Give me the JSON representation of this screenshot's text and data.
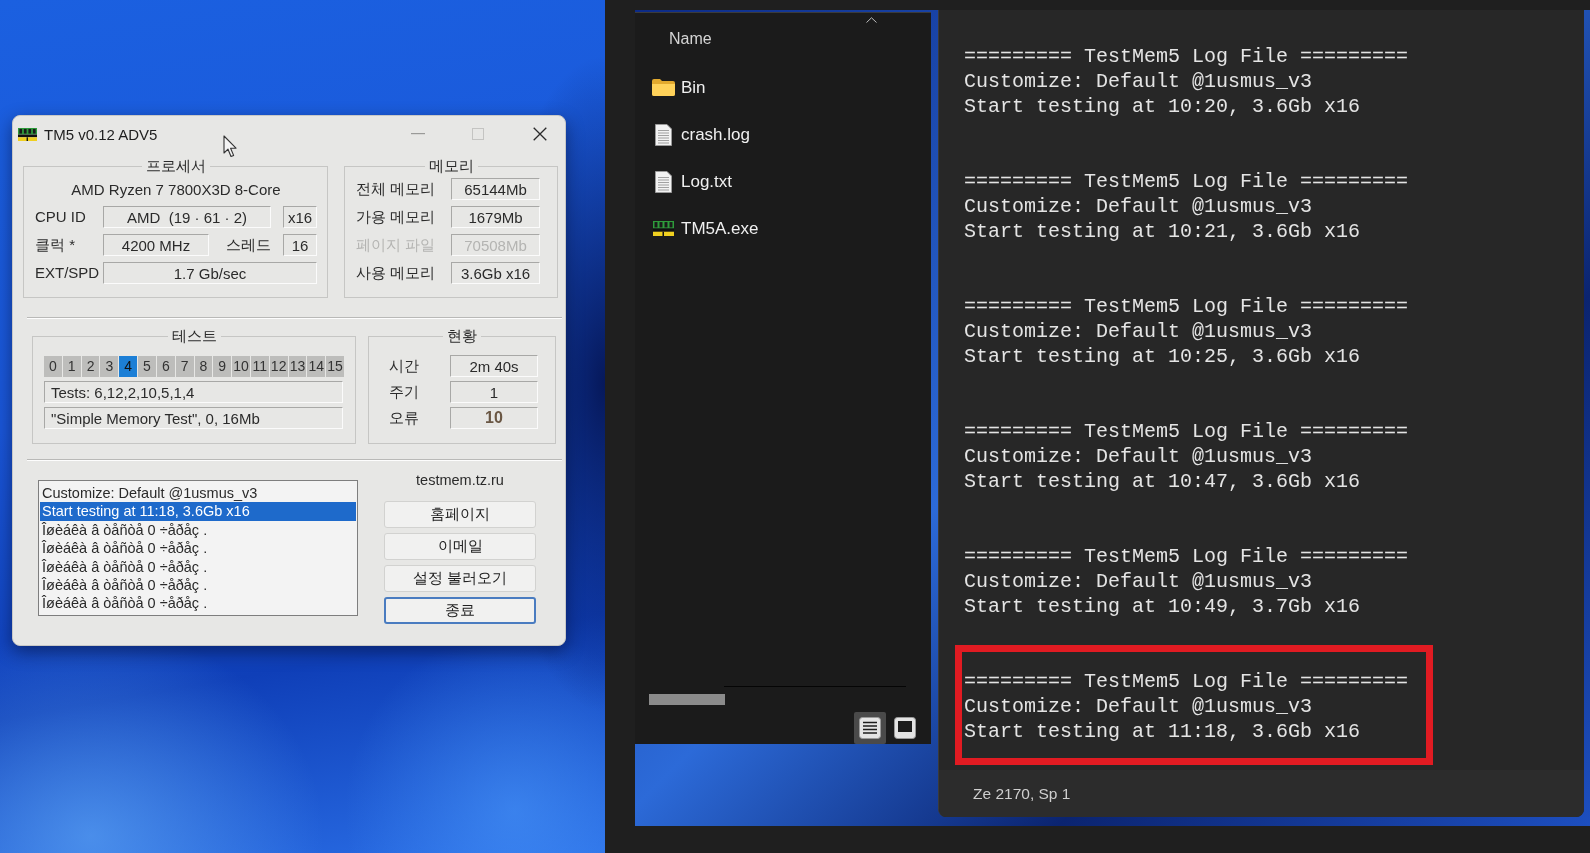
{
  "tm5_window": {
    "title": "TM5 v0.12 ADV5",
    "processor": {
      "heading": "프로세서",
      "model": "AMD Ryzen 7 7800X3D 8-Core",
      "cpu_id_label": "CPU ID",
      "cpu_id": "AMD  (19 · 61 · 2)",
      "cpu_id_side_value": "x16",
      "clock_label": "클럭 *",
      "clock": "4200 MHz",
      "threads_label": "스레드",
      "threads": "16",
      "ext_spd_label": "EXT/SPD",
      "ext_spd": "1.7 Gb/sec"
    },
    "memory": {
      "heading": "메모리",
      "rows": [
        {
          "label": "전체 메모리",
          "value": "65144Mb",
          "disabled": false
        },
        {
          "label": "가용 메모리",
          "value": "1679Mb",
          "disabled": false
        },
        {
          "label": "페이지 파일",
          "value": "70508Mb",
          "disabled": true
        },
        {
          "label": "사용 메모리",
          "value": "3.6Gb x16",
          "disabled": false
        }
      ]
    },
    "test": {
      "heading": "테스트",
      "cells": [
        {
          "label": "0",
          "selected": false
        },
        {
          "label": "1",
          "selected": false
        },
        {
          "label": "2",
          "selected": false
        },
        {
          "label": "3",
          "selected": false
        },
        {
          "label": "4",
          "selected": true
        },
        {
          "label": "5",
          "selected": false
        },
        {
          "label": "6",
          "selected": false
        },
        {
          "label": "7",
          "selected": false
        },
        {
          "label": "8",
          "selected": false
        },
        {
          "label": "9",
          "selected": false
        },
        {
          "label": "10",
          "selected": false
        },
        {
          "label": "11",
          "selected": false
        },
        {
          "label": "12",
          "selected": false
        },
        {
          "label": "13",
          "selected": false
        },
        {
          "label": "14",
          "selected": false
        },
        {
          "label": "15",
          "selected": false
        }
      ],
      "sequence": "Tests: 6,12,2,10,5,1,4",
      "current": "\"Simple Memory Test\", 0, 16Mb"
    },
    "status": {
      "heading": "현황",
      "rows": [
        {
          "label": "시간",
          "value": "2m 40s",
          "kind": "plain"
        },
        {
          "label": "주기",
          "value": "1",
          "kind": "plain"
        },
        {
          "label": "오류",
          "value": "10",
          "kind": "error"
        }
      ]
    },
    "log": [
      {
        "text": "Customize: Default @1usmus_v3",
        "selected": false
      },
      {
        "text": "Start testing at 11:18, 3.6Gb x16",
        "selected": true
      },
      {
        "text": "Îøèáêà â òåñòå 0 ÷åðåç .",
        "selected": false
      },
      {
        "text": "Îøèáêà â òåñòå 0 ÷åðåç .",
        "selected": false
      },
      {
        "text": "Îøèáêà â òåñòå 0 ÷åðåç .",
        "selected": false
      },
      {
        "text": "Îøèáêà â òåñòå 0 ÷åðåç .",
        "selected": false
      },
      {
        "text": "Îøèáêà â òåñòå 0 ÷åðåç .",
        "selected": false
      }
    ],
    "site": "testmem.tz.ru",
    "buttons": [
      {
        "label": "홈페이지",
        "focused": false
      },
      {
        "label": "이메일",
        "focused": false
      },
      {
        "label": "설정 불러오기",
        "focused": false
      },
      {
        "label": "종료",
        "focused": true
      }
    ]
  },
  "explorer": {
    "column": "Name",
    "items": [
      {
        "name": "Bin",
        "kind": "folder"
      },
      {
        "name": "crash.log",
        "kind": "file"
      },
      {
        "name": "Log.txt",
        "kind": "file"
      },
      {
        "name": "TM5A.exe",
        "kind": "app"
      }
    ],
    "views": [
      {
        "kind": "details",
        "selected": true
      },
      {
        "kind": "thumbnails",
        "selected": false
      }
    ]
  },
  "log_viewer": {
    "entries": [
      {
        "lines": [
          "========= TestMem5 Log File =========",
          "Customize: Default @1usmus_v3",
          "Start testing at 10:20, 3.6Gb x16"
        ],
        "highlighted": false
      },
      {
        "lines": [
          "========= TestMem5 Log File =========",
          "Customize: Default @1usmus_v3",
          "Start testing at 10:21, 3.6Gb x16"
        ],
        "highlighted": false
      },
      {
        "lines": [
          "========= TestMem5 Log File =========",
          "Customize: Default @1usmus_v3",
          "Start testing at 10:25, 3.6Gb x16"
        ],
        "highlighted": false
      },
      {
        "lines": [
          "========= TestMem5 Log File =========",
          "Customize: Default @1usmus_v3",
          "Start testing at 10:47, 3.6Gb x16"
        ],
        "highlighted": false
      },
      {
        "lines": [
          "========= TestMem5 Log File =========",
          "Customize: Default @1usmus_v3",
          "Start testing at 10:49, 3.7Gb x16"
        ],
        "highlighted": false
      },
      {
        "lines": [
          "========= TestMem5 Log File =========",
          "Customize: Default @1usmus_v3",
          "Start testing at 11:18, 3.6Gb x16"
        ],
        "highlighted": true
      }
    ],
    "status_bar": "Ze 2170, Sp 1"
  }
}
